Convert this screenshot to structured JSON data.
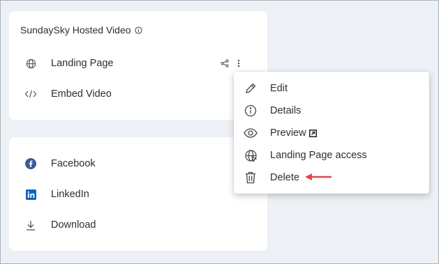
{
  "hosted_card": {
    "title": "SundaySky Hosted Video",
    "items": [
      {
        "label": "Landing Page",
        "icon": "globe-icon"
      },
      {
        "label": "Embed Video",
        "icon": "code-icon"
      }
    ]
  },
  "share_card": {
    "items": [
      {
        "label": "Facebook",
        "icon": "facebook-icon"
      },
      {
        "label": "LinkedIn",
        "icon": "linkedin-icon"
      },
      {
        "label": "Download",
        "icon": "download-icon"
      }
    ]
  },
  "context_menu": {
    "items": [
      {
        "label": "Edit",
        "icon": "pencil-icon"
      },
      {
        "label": "Details",
        "icon": "info-icon"
      },
      {
        "label": "Preview",
        "icon": "eye-icon"
      },
      {
        "label": "Landing Page access",
        "icon": "globe-access-icon"
      },
      {
        "label": "Delete",
        "icon": "trash-icon"
      }
    ]
  },
  "colors": {
    "background": "#edf1f6",
    "card": "#ffffff",
    "text": "#2c2f36",
    "facebook": "#3b5a98",
    "linkedin": "#0a66c2",
    "annotation_arrow": "#e4474b"
  }
}
